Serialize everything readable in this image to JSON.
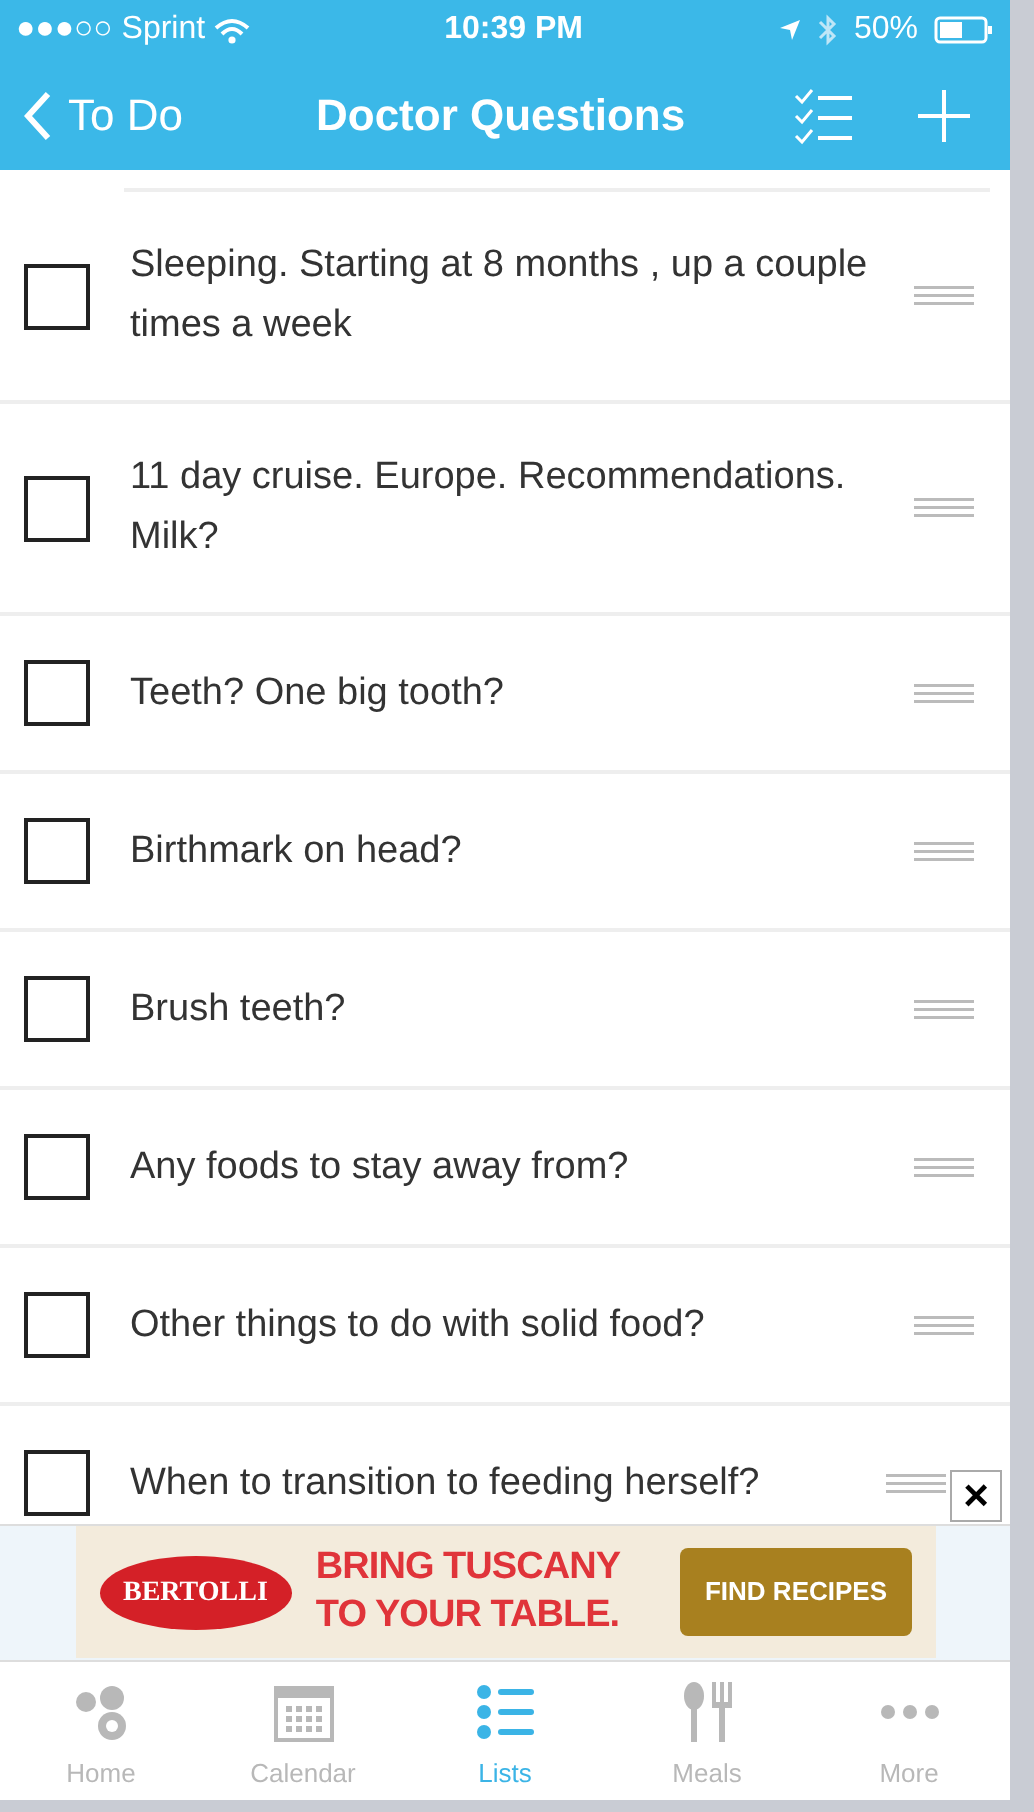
{
  "status_bar": {
    "carrier": "●●●○○ Sprint",
    "time": "10:39 PM",
    "battery": "50%"
  },
  "nav_bar": {
    "back": "To Do",
    "title": "Doctor Questions"
  },
  "items": [
    {
      "text": "Sleeping. Starting at 8 months , up a couple times a week",
      "checked": false
    },
    {
      "text": "11 day cruise. Europe. Recommendations. Milk?",
      "checked": false
    },
    {
      "text": "Teeth? One big tooth?",
      "checked": false
    },
    {
      "text": "Birthmark on head?",
      "checked": false
    },
    {
      "text": "Brush teeth?",
      "checked": false
    },
    {
      "text": "Any foods to stay away from?",
      "checked": false
    },
    {
      "text": "Other things to do with solid food?",
      "checked": false
    },
    {
      "text": "When to transition to feeding herself?",
      "checked": false
    }
  ],
  "ad": {
    "close": "×",
    "brand": "BERTOLLI",
    "headline_1": "BRING TUSCANY",
    "headline_2": "TO YOUR TABLE.",
    "cta": "FIND RECIPES"
  },
  "tabs": [
    {
      "label": "Home",
      "kind": "home",
      "selected": false
    },
    {
      "label": "Calendar",
      "kind": "calendar",
      "selected": false
    },
    {
      "label": "Lists",
      "kind": "lists",
      "selected": true
    },
    {
      "label": "Meals",
      "kind": "meals",
      "selected": false
    },
    {
      "label": "More",
      "kind": "more",
      "selected": false
    }
  ]
}
